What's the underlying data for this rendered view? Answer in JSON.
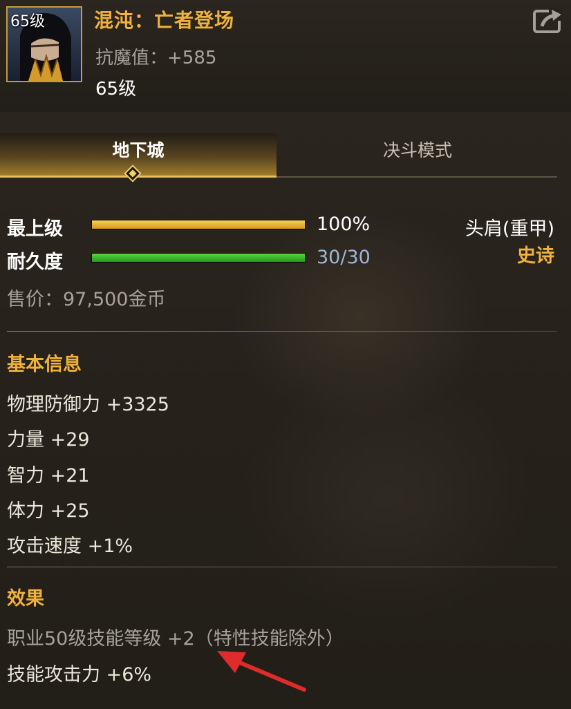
{
  "header": {
    "portrait_level": "65级",
    "item_name": "混沌：亡者登场",
    "anti_magic_label": "抗魔值：",
    "anti_magic_value": "+585",
    "level": "65级",
    "share_icon": "share-export-icon"
  },
  "tabs": [
    {
      "label": "地下城",
      "active": true
    },
    {
      "label": "决斗模式",
      "active": false
    }
  ],
  "bars": {
    "grade": {
      "label": "最上级",
      "value": "100%",
      "fill": 1.0,
      "color": "#f0b23a"
    },
    "durability": {
      "label": "耐久度",
      "value": "30/30",
      "fill": 1.0,
      "color": "#3cbf2a"
    }
  },
  "item_type": {
    "slot": "头肩(重甲)",
    "rarity": "史诗"
  },
  "price": "售价：97,500金币",
  "basic_info": {
    "title": "基本信息",
    "stats": [
      "物理防御力 +3325",
      "力量 +29",
      "智力 +21",
      "体力 +25",
      "攻击速度 +1%"
    ]
  },
  "effects": {
    "title": "效果",
    "lines": [
      "职业50级技能等级 +2（特性技能除外）",
      "技能攻击力 +6%"
    ]
  },
  "colors": {
    "accent_gold": "#f0b23a",
    "annotation_red": "#e02b2b"
  }
}
